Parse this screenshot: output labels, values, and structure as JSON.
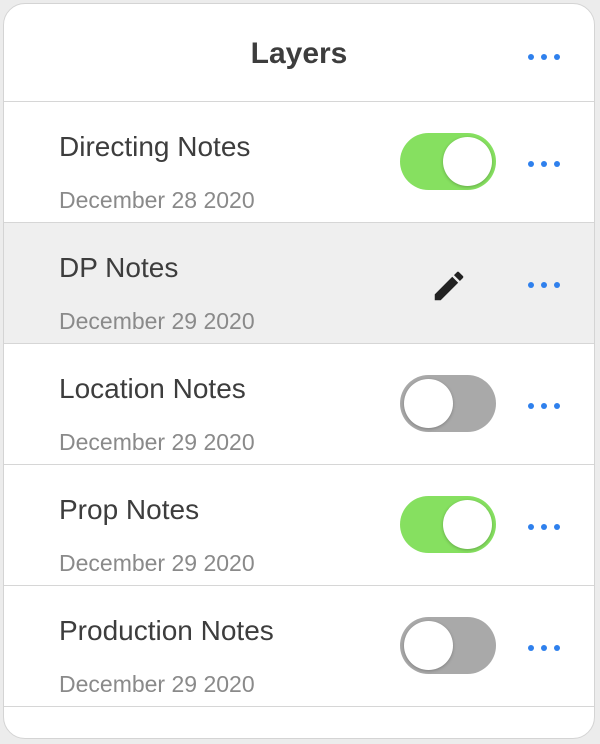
{
  "header": {
    "title": "Layers"
  },
  "layers": [
    {
      "name": "Directing Notes",
      "date": "December 28 2020",
      "toggle": "on"
    },
    {
      "name": "DP Notes",
      "date": "December 29 2020",
      "toggle": "edit"
    },
    {
      "name": "Location Notes",
      "date": "December 29 2020",
      "toggle": "off"
    },
    {
      "name": "Prop Notes",
      "date": "December 29 2020",
      "toggle": "on"
    },
    {
      "name": "Production Notes",
      "date": "December 29 2020",
      "toggle": "off"
    }
  ],
  "colors": {
    "accent": "#2f80ed",
    "toggle_on": "#86e060",
    "toggle_off": "#a9a9a9",
    "selected_row": "#efefef"
  },
  "icons": {
    "more": "more-dots-icon",
    "edit": "pencil-icon"
  }
}
